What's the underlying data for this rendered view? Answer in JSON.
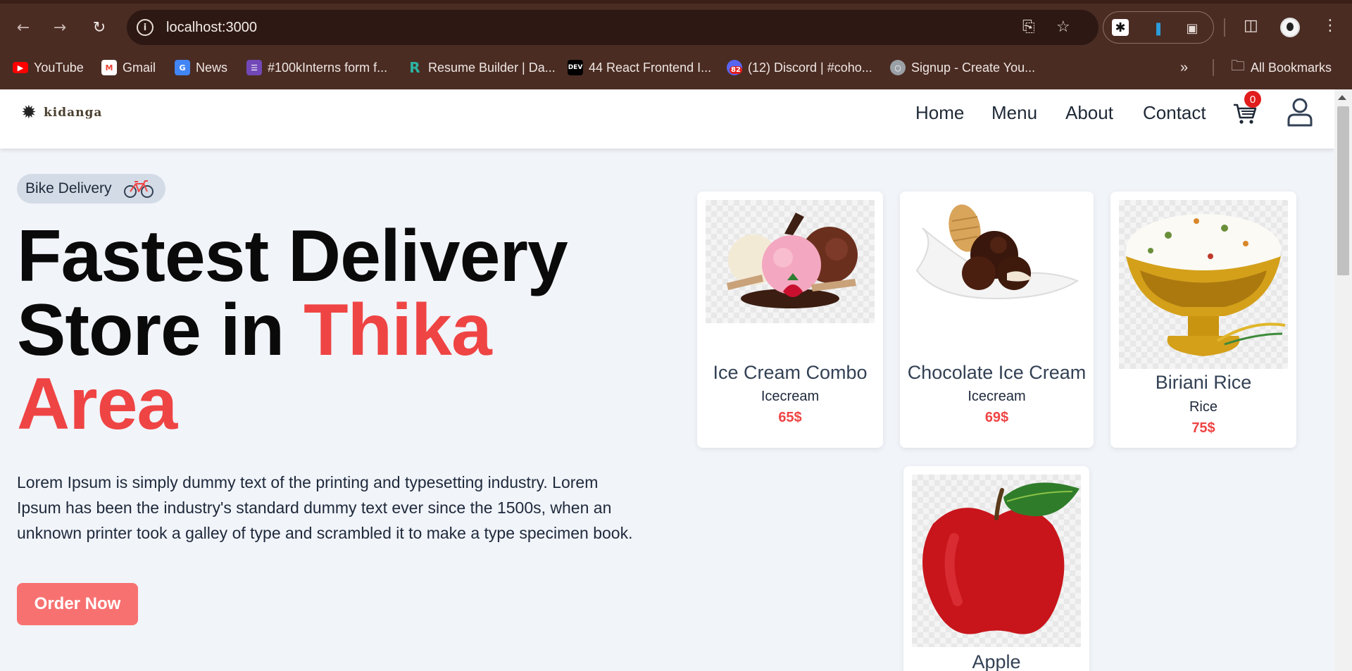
{
  "browser": {
    "url": "localhost:3000",
    "bookmarks": [
      {
        "label": "YouTube",
        "icon": "youtube-icon",
        "color": "#ff0000"
      },
      {
        "label": "Gmail",
        "icon": "gmail-icon",
        "color": "#ea4335"
      },
      {
        "label": "News",
        "icon": "news-icon",
        "color": "#4285f4"
      },
      {
        "label": "#100kInterns form f...",
        "icon": "forms-icon",
        "color": "#7248b9"
      },
      {
        "label": "Resume Builder | Da...",
        "icon": "resume-icon",
        "color": "#2bb3a3"
      },
      {
        "label": "44 React Frontend I...",
        "icon": "dev-icon",
        "color": "#000000"
      },
      {
        "label": "(12) Discord | #coho...",
        "icon": "discord-icon",
        "color": "#5865f2",
        "badge": "82"
      },
      {
        "label": "Signup - Create You...",
        "icon": "globe-icon",
        "color": "#9aa0a6"
      }
    ],
    "all_bookmarks": "All Bookmarks"
  },
  "site": {
    "logo": "kidanga",
    "nav": [
      "Home",
      "Menu",
      "About",
      "Contact"
    ],
    "cart_count": "0"
  },
  "hero": {
    "badge": "Bike Delivery",
    "headline_line1": "Fastest Delivery",
    "headline_line2_plain": "Store in ",
    "headline_line2_accent": "Thika",
    "headline_line3_accent": "Area",
    "description": "Lorem Ipsum is simply dummy text of the printing and typesetting industry. Lorem Ipsum has been the industry's standard dummy text ever since the 1500s, when an unknown printer took a galley of type and scrambled it to make a type specimen book.",
    "cta": "Order Now"
  },
  "products": [
    {
      "title": "Ice Cream Combo",
      "category": "Icecream",
      "price": "65$"
    },
    {
      "title": "Chocolate Ice Cream",
      "category": "Icecream",
      "price": "69$"
    },
    {
      "title": "Biriani Rice",
      "category": "Rice",
      "price": "75$"
    },
    {
      "title": "Apple",
      "category": "",
      "price": ""
    }
  ],
  "colors": {
    "accent": "#ef4444",
    "button": "#f87171",
    "chrome": "#4a2c23"
  }
}
